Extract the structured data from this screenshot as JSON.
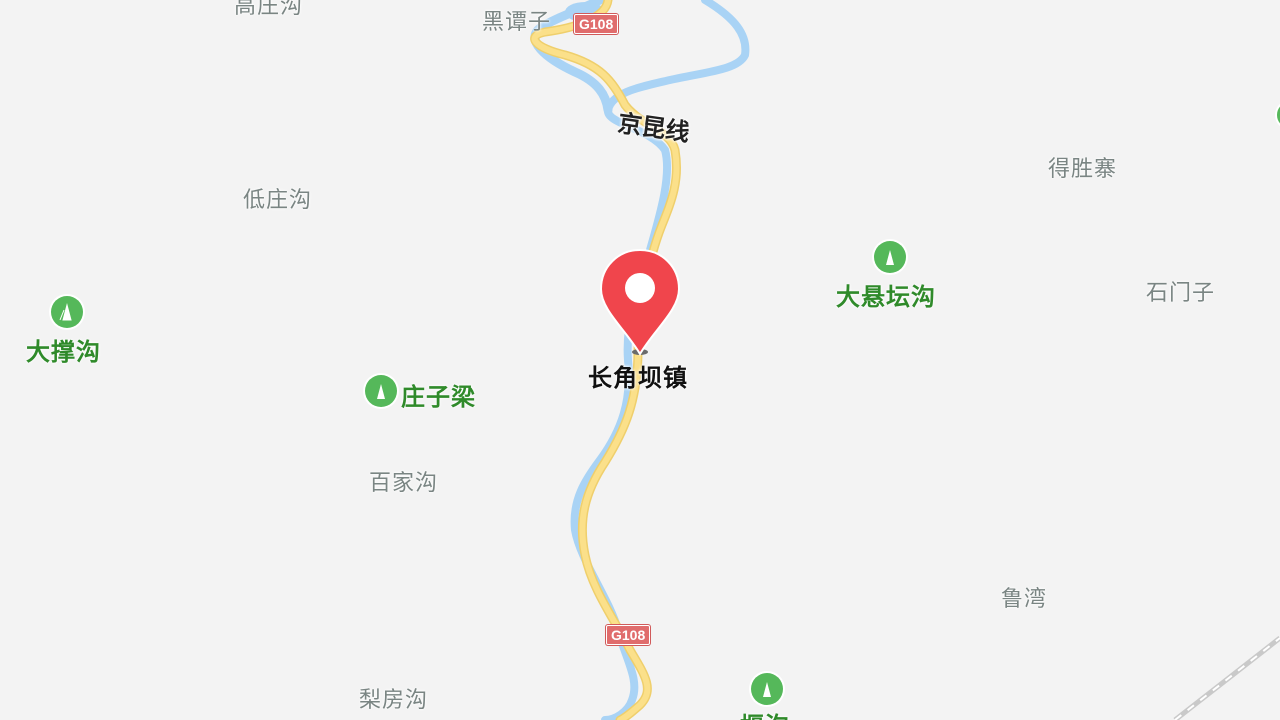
{
  "map": {
    "colors": {
      "background": "#f3f3f3",
      "river": "#a9d3f5",
      "highway": "#fbe08a",
      "poi_text": "#2f8a2a",
      "place_text": "#7a8583",
      "marker": "#f0454c"
    },
    "highway_shields": [
      "G108",
      "G108"
    ],
    "railway_label": "京昆线",
    "marker": {
      "icon": "location-pin-icon",
      "label": "长角坝镇"
    },
    "places": [
      "高庄沟",
      "黑谭子",
      "低庄沟",
      "得胜寨",
      "石门子",
      "百家沟",
      "鲁湾",
      "梨房沟"
    ],
    "pois": [
      "大撑沟",
      "大悬坛沟",
      "庄子梁",
      "堰沟"
    ]
  }
}
